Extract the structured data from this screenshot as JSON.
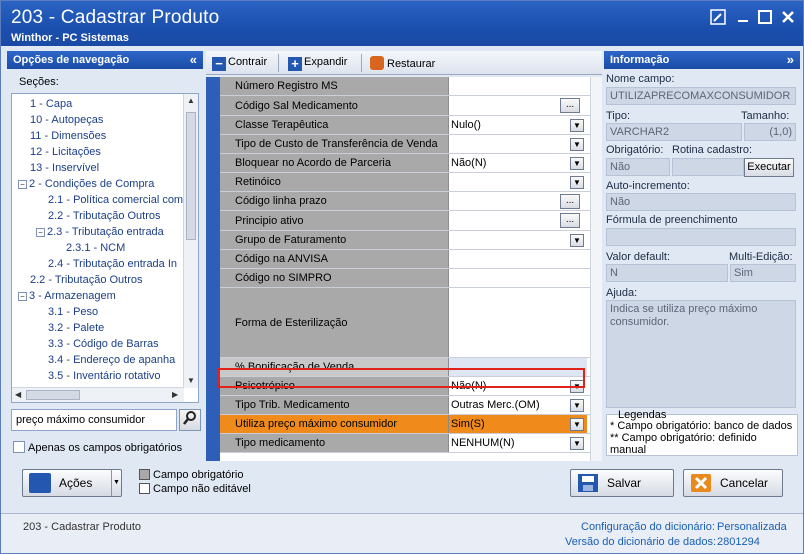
{
  "window": {
    "title": "203 - Cadastrar  Produto",
    "subtitle": "Winthor - PC Sistemas"
  },
  "nav": {
    "header": "Opções de navegação",
    "collapse_glyph": "«",
    "secoes_label": "Seções:",
    "tree": [
      {
        "label": "1 - Capa",
        "level": 0,
        "toggle": ""
      },
      {
        "label": "10 - Autopeças",
        "level": 0,
        "toggle": ""
      },
      {
        "label": "11 - Dimensões",
        "level": 0,
        "toggle": ""
      },
      {
        "label": "12 - Licitações",
        "level": 0,
        "toggle": ""
      },
      {
        "label": "13 - Inservível",
        "level": 0,
        "toggle": ""
      },
      {
        "label": "2 - Condições de Compra",
        "level": 0,
        "toggle": "−"
      },
      {
        "label": "2.1 - Política comercial comp",
        "level": 1,
        "toggle": ""
      },
      {
        "label": "2.2 - Tributação Outros",
        "level": 1,
        "toggle": ""
      },
      {
        "label": "2.3 - Tributação entrada",
        "level": 1,
        "toggle": "−"
      },
      {
        "label": "2.3.1 - NCM",
        "level": 2,
        "toggle": ""
      },
      {
        "label": "2.4 - Tributação entrada In",
        "level": 1,
        "toggle": ""
      },
      {
        "label": "2.2 - Tributação Outros",
        "level": 0,
        "toggle": ""
      },
      {
        "label": "3 - Armazenagem",
        "level": 0,
        "toggle": "−"
      },
      {
        "label": "3.1 - Peso",
        "level": 1,
        "toggle": ""
      },
      {
        "label": "3.2 - Palete",
        "level": 1,
        "toggle": ""
      },
      {
        "label": "3.3 - Código de Barras",
        "level": 1,
        "toggle": ""
      },
      {
        "label": "3.4 - Endereço de apanha",
        "level": 1,
        "toggle": ""
      },
      {
        "label": "3.5 - Inventário rotativo",
        "level": 1,
        "toggle": ""
      }
    ],
    "search_value": "preço máximo consumidor",
    "only_required_label": "Apenas os campos obrigatórios"
  },
  "toolbar": {
    "collapse_label": "Contrair",
    "expand_label": "Expandir",
    "restore_label": "Restaurar"
  },
  "grid": {
    "rows": [
      {
        "label": "Número Registro MS",
        "value": "",
        "control": "none"
      },
      {
        "label": "Código Sal Medicamento",
        "value": "",
        "control": "ellipsis"
      },
      {
        "label": "Classe Terapêutica",
        "value": "Nulo()",
        "control": "dropdown"
      },
      {
        "label": "Tipo de Custo de Transferência de Venda",
        "value": "",
        "control": "dropdown"
      },
      {
        "label": "Bloquear no Acordo de Parceria",
        "value": "Não(N)",
        "control": "dropdown"
      },
      {
        "label": "Retinóico",
        "value": "",
        "control": "dropdown"
      },
      {
        "label": "Código linha prazo",
        "value": "",
        "control": "ellipsis"
      },
      {
        "label": "Principio ativo",
        "value": "",
        "control": "ellipsis"
      },
      {
        "label": "Grupo de Faturamento",
        "value": "",
        "control": "dropdown"
      },
      {
        "label": "Código na ANVISA",
        "value": "",
        "control": "none"
      },
      {
        "label": "Código no SIMPRO",
        "value": "",
        "control": "none"
      },
      {
        "label": "Forma de Esterilização",
        "value": "",
        "control": "none"
      },
      {
        "label": "% Bonificação de Venda",
        "value": "",
        "control": "none"
      },
      {
        "label": "Psicotrópico",
        "value": "Não(N)",
        "control": "dropdown"
      },
      {
        "label": "Tipo Trib. Medicamento",
        "value": "Outras Merc.(OM)",
        "control": "dropdown"
      },
      {
        "label": "Utiliza preço máximo consumidor",
        "value": "Sim(S)",
        "control": "dropdown"
      },
      {
        "label": "Tipo medicamento",
        "value": "NENHUM(N)",
        "control": "dropdown"
      }
    ]
  },
  "info": {
    "header": "Informação",
    "expand_glyph": "»",
    "nome_campo_label": "Nome campo:",
    "nome_campo_value": "UTILIZAPRECOMAXCONSUMIDOR",
    "tipo_label": "Tipo:",
    "tamanho_label": "Tamanho:",
    "tipo_value": "VARCHAR2",
    "tamanho_value": "(1,0)",
    "obrigatorio_label": "Obrigatório:",
    "rotina_label": "Rotina cadastro:",
    "obrigatorio_value": "Não",
    "executar_label": "Executar",
    "auto_inc_label": "Auto-incremento:",
    "auto_inc_value": "Não",
    "formula_label": "Fórmula de preenchimento",
    "valor_default_label": "Valor default:",
    "multi_edicao_label": "Multi-Edição:",
    "valor_default_value": "N",
    "multi_edicao_value": "Sim",
    "ajuda_label": "Ajuda:",
    "ajuda_text": "Indica se utiliza preço máximo consumidor.",
    "legendas_title": "Legendas",
    "legend_1": "* Campo obrigatório: banco de dados",
    "legend_2": "** Campo obrigatório: definido manual"
  },
  "bottom": {
    "acoes_label": "Ações",
    "legend_required": "Campo obrigatório",
    "legend_noneditable": "Campo não editável",
    "salvar_label": "Salvar",
    "cancelar_label": "Cancelar"
  },
  "status": {
    "left_text": "203 - Cadastrar  Produto",
    "config_label": "Configuração do dicionário:",
    "config_value": "Personalizada",
    "version_label": "Versão do dicionário de dados:",
    "version_value": "2801294"
  },
  "colors": {
    "title_blue": "#1b4fae",
    "selected_row": "#f08a1a",
    "selection_border": "#e0221b",
    "grid_label_bg": "#a9a9a9",
    "link_blue": "#1a5fb4"
  }
}
